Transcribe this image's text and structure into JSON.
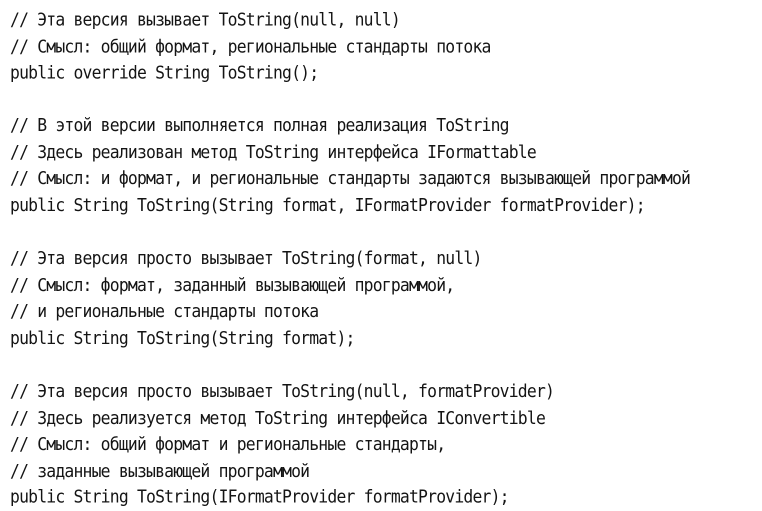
{
  "blocks": [
    {
      "lines": [
        "// Эта версия вызывает ToString(null, null)",
        "// Смысл: общий формат, региональные стандарты потока",
        "public override String ToString();"
      ]
    },
    {
      "lines": [
        "// В этой версии выполняется полная реализация ToString",
        "// Здесь реализован метод ToString интерфейса IFormattable",
        "// Смысл: и формат, и региональные стандарты задаются вызывающей программой",
        "public String ToString(String format, IFormatProvider formatProvider);"
      ]
    },
    {
      "lines": [
        "// Эта версия просто вызывает ToString(format, null)",
        "// Смысл: формат, заданный вызывающей программой,",
        "// и региональные стандарты потока",
        "public String ToString(String format);"
      ]
    },
    {
      "lines": [
        "// Эта версия просто вызывает ToString(null, formatProvider)",
        "// Здесь реализуется метод ToString интерфейса IConvertible",
        "// Смысл: общий формат и региональные стандарты,",
        "// заданные вызывающей программой",
        "public String ToString(IFormatProvider formatProvider);"
      ]
    }
  ]
}
